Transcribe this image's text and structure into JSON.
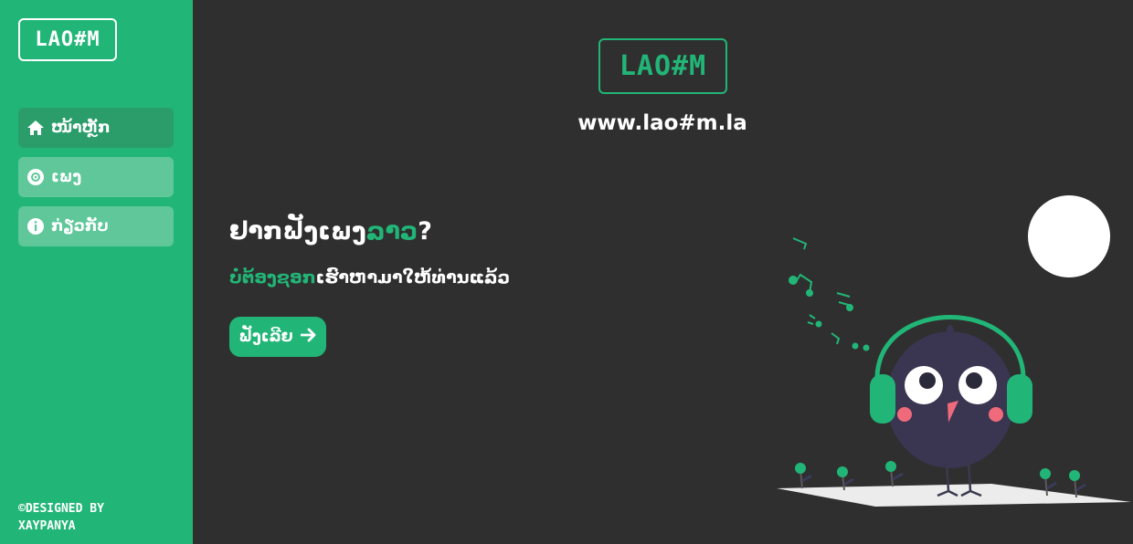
{
  "brand": {
    "logo_text": "LAO#M",
    "accent_color": "#21b677",
    "bg_color": "#2f2f2f"
  },
  "sidebar": {
    "items": [
      {
        "label": "ໜ້າຫຼັກ",
        "icon": "home-icon",
        "active": true
      },
      {
        "label": "ເພງ",
        "icon": "disc-icon",
        "active": false
      },
      {
        "label": "ກ່ຽວກັບ",
        "icon": "info-icon",
        "active": false
      }
    ],
    "credit_line1": "©DESIGNED BY",
    "credit_line2": "XAYPANYA"
  },
  "main": {
    "url": "www.lao#m.la",
    "hero_title_prefix": "ຢາກຟັງເພງ",
    "hero_title_accent": "ລາວ",
    "hero_title_suffix": "?",
    "hero_sub_accent": "ບໍ່ຕ້ອງຊອກ",
    "hero_sub_rest": "ເຮົາຫາມາໃຫ້ທ່ານແລ້ວ",
    "cta_label": "ຟັງເລີຍ",
    "cta_icon": "arrow-right-icon"
  }
}
